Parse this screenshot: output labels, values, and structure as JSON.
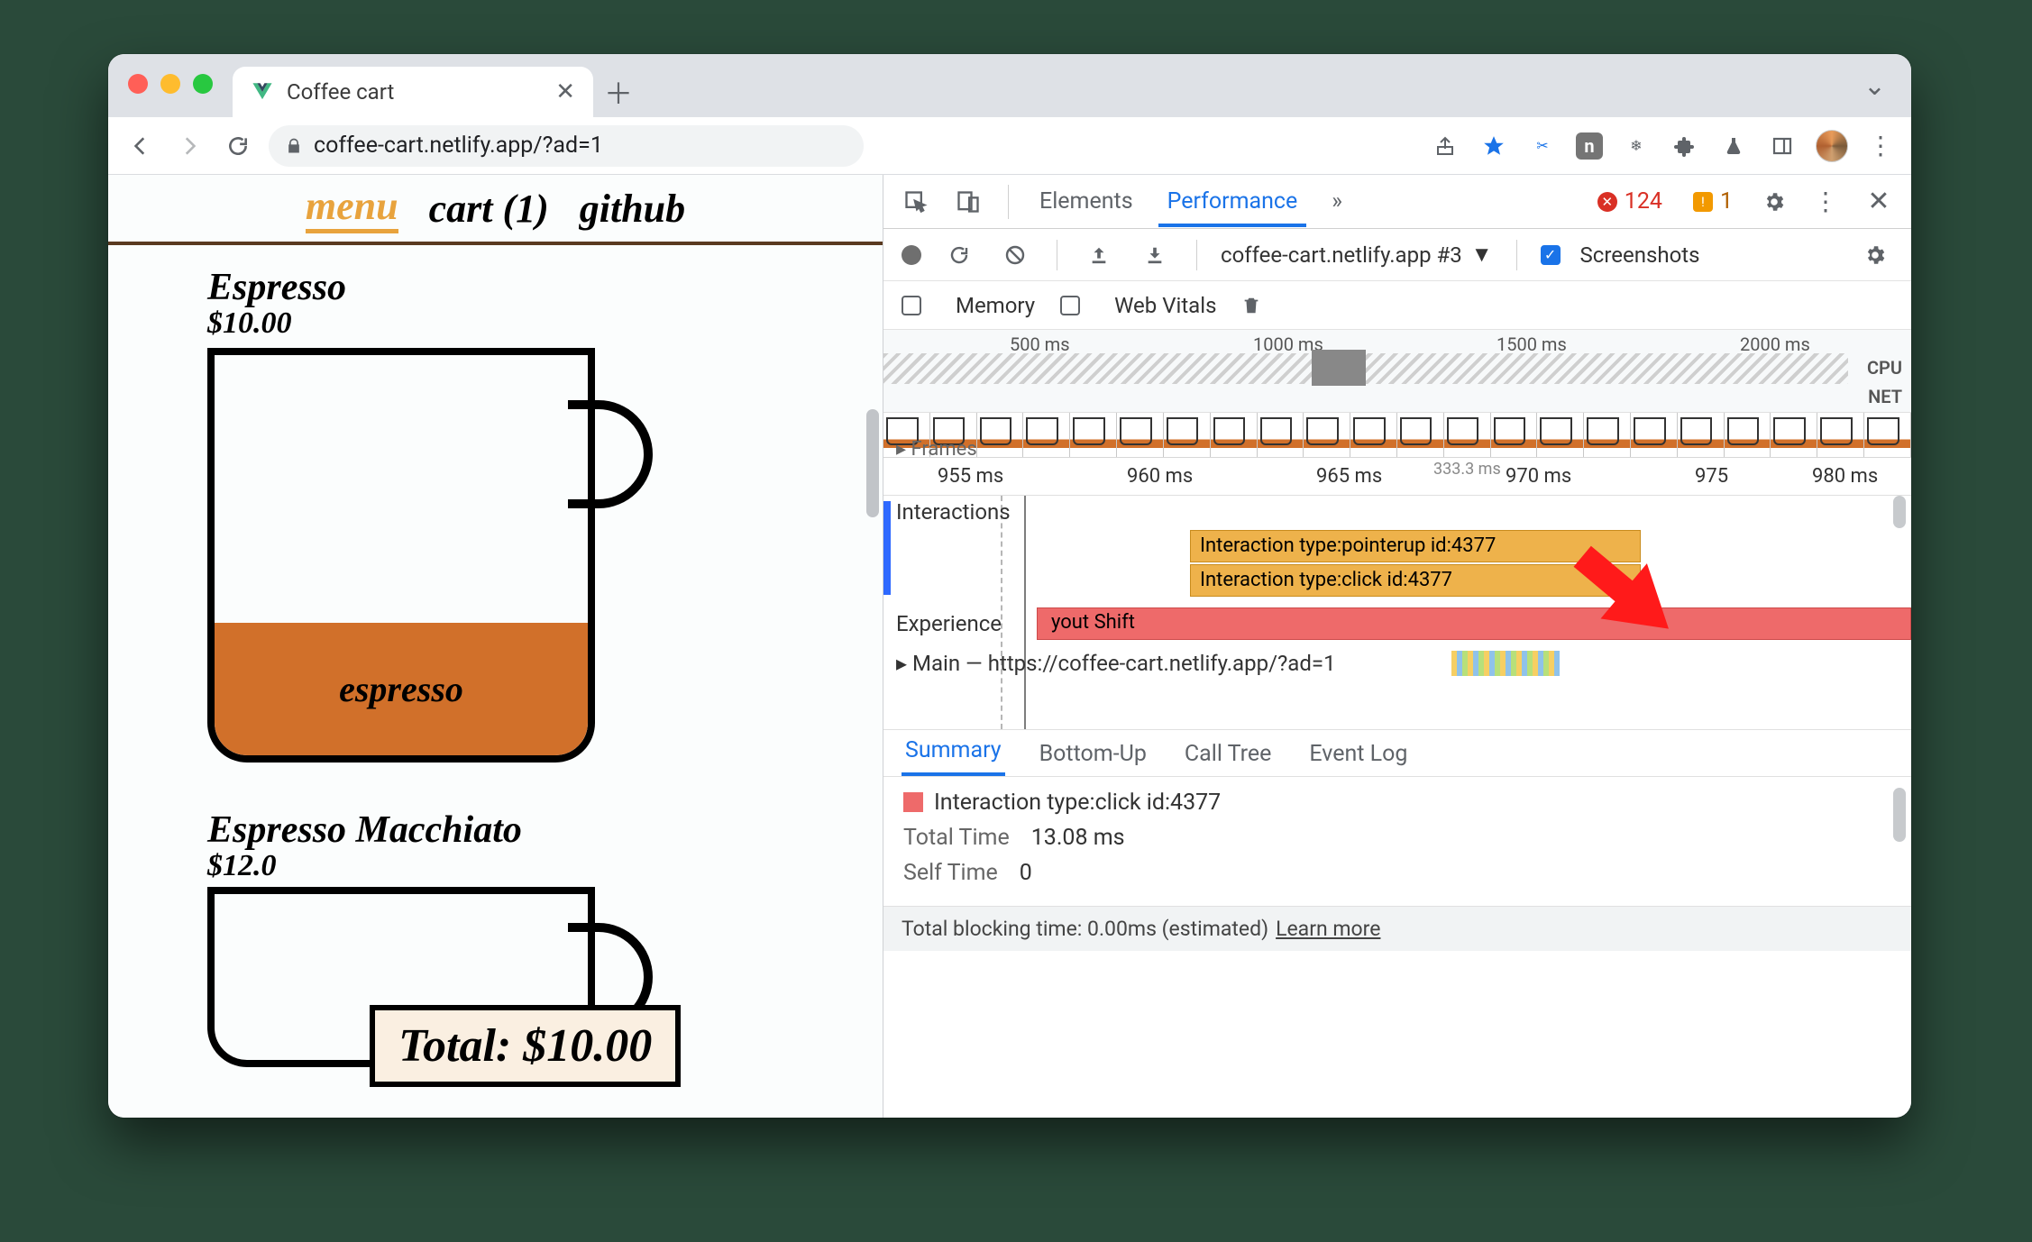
{
  "browser": {
    "tab_title": "Coffee cart",
    "url_display": "coffee-cart.netlify.app/?ad=1"
  },
  "site": {
    "nav": {
      "menu": "menu",
      "cart": "cart (1)",
      "github": "github"
    },
    "product1": {
      "name": "Espresso",
      "price": "$10.00",
      "fill_label": "espresso"
    },
    "product2": {
      "name": "Espresso Macchiato",
      "price": "$12.0"
    },
    "total_label": "Total: $10.00"
  },
  "devtools": {
    "tabs": {
      "elements": "Elements",
      "performance": "Performance",
      "more": "»"
    },
    "counts": {
      "errors": "124",
      "warnings": "1"
    },
    "toolbar2": {
      "profile_select": "coffee-cart.netlify.app #3",
      "screenshots": "Screenshots"
    },
    "toolbar3": {
      "memory": "Memory",
      "webvitals": "Web Vitals"
    },
    "overview_ticks": [
      "500 ms",
      "1000 ms",
      "1500 ms",
      "2000 ms"
    ],
    "overview_labels": {
      "cpu": "CPU",
      "net": "NET"
    },
    "ruler_frames": "Frames",
    "ruler_ticks": [
      "955 ms",
      "960 ms",
      "965 ms",
      "970 ms",
      "975",
      "980 ms"
    ],
    "ruler_span": "333.3 ms",
    "interactions_hdr": "Interactions",
    "band1": "Interaction type:pointerup id:4377",
    "band2": "Interaction type:click id:4377",
    "experience_hdr": "Experience",
    "experience_text": "yout Shift",
    "main_hdr": "Main — https://coffee-cart.netlify.app/?ad=1",
    "subtabs": {
      "summary": "Summary",
      "bottomup": "Bottom-Up",
      "calltree": "Call Tree",
      "eventlog": "Event Log"
    },
    "summary": {
      "title": "Interaction type:click id:4377",
      "total_time_k": "Total Time",
      "total_time_v": "13.08 ms",
      "self_time_k": "Self Time",
      "self_time_v": "0"
    },
    "footer": {
      "tbt": "Total blocking time: 0.00ms (estimated)",
      "learn": "Learn more"
    }
  }
}
